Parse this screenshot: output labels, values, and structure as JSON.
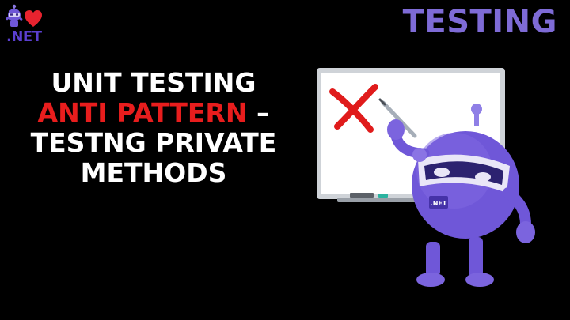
{
  "logo": {
    "text": ".NET",
    "heart_color": "#e8232f",
    "text_color": "#5b3fd0"
  },
  "category": {
    "label": "TESTING",
    "color": "#7e6bd6"
  },
  "headline": {
    "line1": "UNIT TESTING",
    "line2_red": "ANTI PATTERN",
    "line2_rest": " –",
    "line3": "TESTNG PRIVATE",
    "line4": "METHODS",
    "red_color": "#e81d1d"
  },
  "illustration": {
    "whiteboard_mark": "x-mark-icon",
    "robot_badge": ".NET",
    "robot_color": "#6f57d8"
  }
}
